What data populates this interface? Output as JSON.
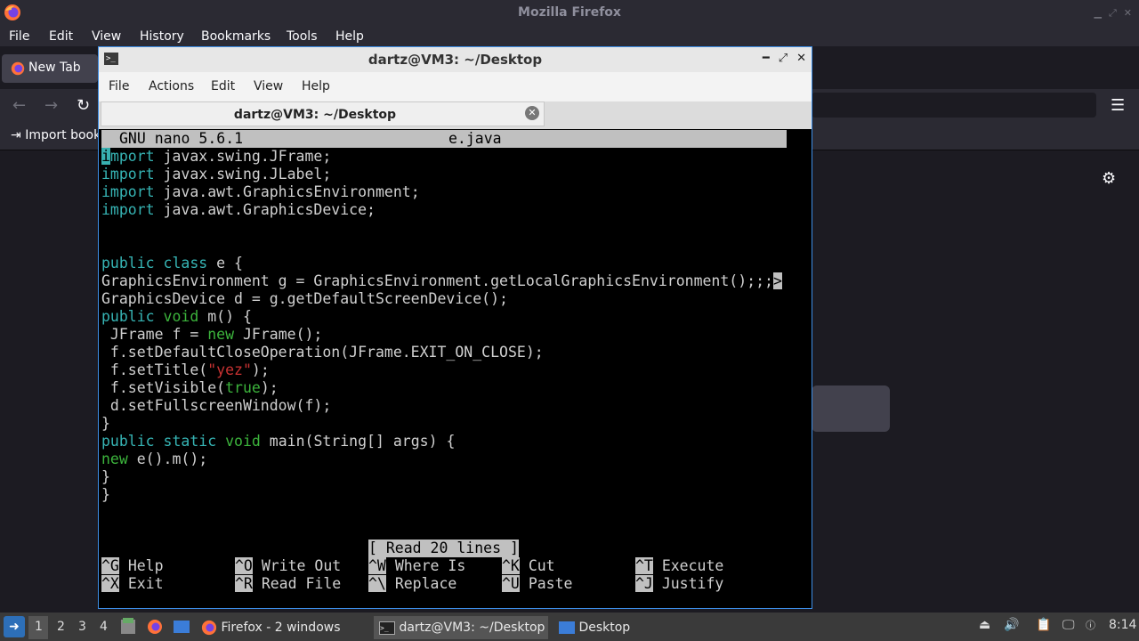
{
  "colors": {
    "firefox_bg": "#1c1b22",
    "firefox_bar": "#2b2a33",
    "terminal_border": "#3d8ee6",
    "nano_keyword": "#36b4b4",
    "nano_green": "#3cb43c",
    "nano_string": "#c83232",
    "taskbar": "#3a3a3a"
  },
  "firefox": {
    "window_title": "Mozilla Firefox",
    "menu": [
      "File",
      "Edit",
      "View",
      "History",
      "Bookmarks",
      "Tools",
      "Help"
    ],
    "tab_label": "New Tab",
    "import_bookmarks": "Import book",
    "icons": [
      "firefox-logo-icon",
      "back-arrow-icon",
      "forward-arrow-icon",
      "reload-icon",
      "hamburger-menu-icon",
      "gear-icon",
      "import-icon"
    ]
  },
  "terminal": {
    "title": "dartz@VM3: ~/Desktop",
    "menu": [
      "File",
      "Actions",
      "Edit",
      "View",
      "Help"
    ],
    "tab_label": "dartz@VM3: ~/Desktop"
  },
  "nano": {
    "version": "GNU nano 5.6.1",
    "filename": "e.java",
    "overflow_marker": ">",
    "lines": [
      "import javax.swing.JFrame;",
      "import javax.swing.JLabel;",
      "import java.awt.GraphicsEnvironment;",
      "import java.awt.GraphicsDevice;",
      "",
      "",
      "public class e {",
      "GraphicsEnvironment g = GraphicsEnvironment.getLocalGraphicsEnvironment();;;",
      "GraphicsDevice d = g.getDefaultScreenDevice();",
      "public void m() {",
      " JFrame f = new JFrame();",
      " f.setDefaultCloseOperation(JFrame.EXIT_ON_CLOSE);",
      " f.setTitle(\"yez\");",
      " f.setVisible(true);",
      " d.setFullscreenWindow(f);",
      "}",
      "public static void main(String[] args) {",
      "new e().m();",
      "}",
      "}"
    ],
    "status": "[ Read 20 lines ]",
    "shortcuts": [
      {
        "key": "^G",
        "label": "Help"
      },
      {
        "key": "^O",
        "label": "Write Out"
      },
      {
        "key": "^W",
        "label": "Where Is"
      },
      {
        "key": "^K",
        "label": "Cut"
      },
      {
        "key": "^T",
        "label": "Execute"
      },
      {
        "key": "^X",
        "label": "Exit"
      },
      {
        "key": "^R",
        "label": "Read File"
      },
      {
        "key": "^\\",
        "label": "Replace"
      },
      {
        "key": "^U",
        "label": "Paste"
      },
      {
        "key": "^J",
        "label": "Justify"
      }
    ]
  },
  "taskbar": {
    "workspaces": [
      "1",
      "2",
      "3",
      "4"
    ],
    "tasks": [
      "Firefox - 2 windows",
      "dartz@VM3: ~/Desktop",
      "Desktop"
    ],
    "clock": "8:14"
  }
}
